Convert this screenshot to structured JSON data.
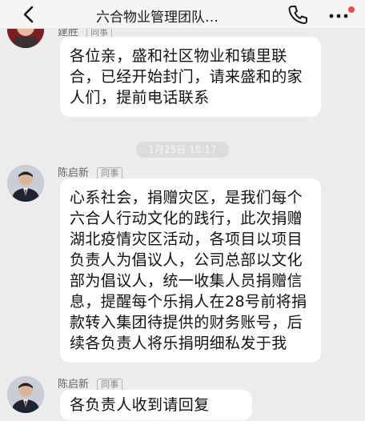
{
  "header": {
    "title": "六合物业管理团队…",
    "back_icon": "chevron-left-icon",
    "call_icon": "phone-icon",
    "more_icon": "more-dots-icon"
  },
  "messages": [
    {
      "sender": "建胜",
      "tag": "同事",
      "text": "各位亲，盛和社区物业和镇里联合，已经开始封门，请来盛和的家人们，提前电话联系"
    },
    {
      "sender": "陈启新",
      "tag": "同事",
      "text": "心系社会，捐赠灾区，是我们每个六合人行动文化的践行，此次捐赠湖北疫情灾区活动，各项目以项目负责人为倡议人，公司总部以文化部为倡议人，统一收集人员捐赠信息，提醒每个乐捐人在28号前将捐款转入集团待提供的财务账号，后续各负责人将乐捐明细私发于我"
    },
    {
      "sender": "陈启新",
      "tag": "同事",
      "text": "各负责人收到请回复"
    }
  ],
  "timestamp": "1月25日 18:17"
}
